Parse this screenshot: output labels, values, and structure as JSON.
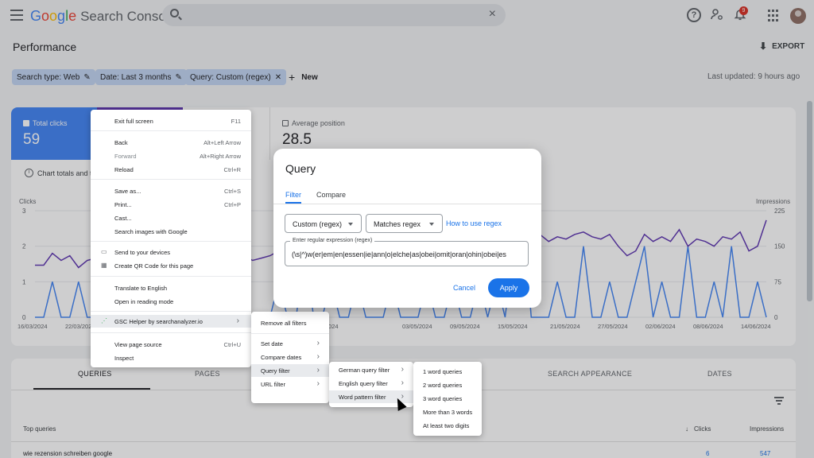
{
  "app": {
    "logo_google": [
      "G",
      "o",
      "o",
      "g",
      "l",
      "e"
    ],
    "logo_product": "Search Console",
    "clear_icon": "×",
    "notification_count": "9"
  },
  "header": {
    "title": "Performance",
    "export_label": "EXPORT",
    "last_updated": "Last updated: 9 hours ago"
  },
  "filters": {
    "chips": [
      {
        "label": "Search type: Web"
      },
      {
        "label": "Date: Last 3 months"
      },
      {
        "label": "Query: Custom (regex)"
      }
    ],
    "new_label": "New"
  },
  "metrics": {
    "total_clicks_label": "Total clicks",
    "total_clicks_value": "59",
    "avg_position_label": "Average position",
    "avg_position_value": "28.5",
    "note": "Chart totals and tal"
  },
  "chart_data": {
    "type": "line",
    "yaxis_left_label": "Clicks",
    "yaxis_right_label": "Impressions",
    "yticks_left": [
      "3",
      "2",
      "1",
      "0"
    ],
    "yticks_right": [
      "225",
      "150",
      "75",
      "0"
    ],
    "xtick_labels": [
      "16/03/2024",
      "22/03/2024",
      "27/04/2024",
      "03/05/2024",
      "09/05/2024",
      "15/05/2024",
      "21/05/2024",
      "27/05/2024",
      "02/06/2024",
      "08/06/2024",
      "14/06/2024"
    ],
    "ylim_left": [
      0,
      3
    ],
    "ylim_right": [
      0,
      225
    ],
    "series": [
      {
        "name": "Clicks",
        "color": "#4285f4",
        "values": [
          0,
          0,
          1,
          0,
          0,
          1,
          0,
          0,
          1,
          0,
          1,
          0,
          0,
          1,
          0,
          1,
          0,
          1,
          0,
          0,
          0,
          1,
          0,
          1,
          0,
          0,
          0,
          0,
          1,
          0,
          0,
          2,
          0,
          0,
          1,
          0,
          0,
          1,
          0,
          0,
          0,
          1,
          0,
          0,
          0,
          1,
          0,
          0,
          1,
          0,
          0,
          1,
          0,
          1,
          0,
          2,
          3,
          0,
          0,
          0,
          1,
          0,
          0,
          2,
          0,
          0,
          1,
          0,
          0,
          1,
          2,
          0,
          1,
          0,
          0,
          2,
          0,
          0,
          1,
          0,
          2,
          0,
          0,
          1,
          0
        ]
      },
      {
        "name": "Impressions",
        "color": "#5e35b1",
        "values": [
          110,
          110,
          135,
          120,
          130,
          105,
          120,
          125,
          95,
          115,
          130,
          120,
          120,
          140,
          120,
          130,
          115,
          140,
          130,
          125,
          120,
          135,
          130,
          140,
          130,
          120,
          125,
          130,
          140,
          130,
          125,
          150,
          140,
          135,
          140,
          150,
          140,
          135,
          145,
          140,
          150,
          140,
          135,
          130,
          145,
          150,
          140,
          135,
          150,
          140,
          135,
          145,
          155,
          150,
          160,
          170,
          180,
          190,
          175,
          160,
          170,
          165,
          175,
          180,
          170,
          165,
          175,
          150,
          130,
          140,
          175,
          160,
          170,
          160,
          185,
          150,
          165,
          160,
          150,
          170,
          165,
          180,
          140,
          150,
          205
        ]
      }
    ]
  },
  "context_menu": {
    "exit_fullscreen": "Exit full screen",
    "exit_fullscreen_sc": "F11",
    "back": "Back",
    "back_sc": "Alt+Left Arrow",
    "forward": "Forward",
    "forward_sc": "Alt+Right Arrow",
    "reload": "Reload",
    "reload_sc": "Ctrl+R",
    "save_as": "Save as...",
    "save_as_sc": "Ctrl+S",
    "print": "Print...",
    "print_sc": "Ctrl+P",
    "cast": "Cast...",
    "search_images": "Search images with Google",
    "send_devices": "Send to your devices",
    "qr_code": "Create QR Code for this page",
    "translate": "Translate to English",
    "reading_mode": "Open in reading mode",
    "gsc_helper": "GSC Helper by searchanalyzer.io",
    "view_source": "View page source",
    "view_source_sc": "Ctrl+U",
    "inspect": "Inspect"
  },
  "submenu1": {
    "remove_all": "Remove all filters",
    "set_date": "Set date",
    "compare_dates": "Compare dates",
    "query_filter": "Query filter",
    "url_filter": "URL filter"
  },
  "submenu2": {
    "german": "German query filter",
    "english": "English query filter",
    "word_pattern": "Word pattern filter"
  },
  "submenu3": {
    "one": "1 word queries",
    "two": "2 word queries",
    "three": "3 word queries",
    "more": "More than 3 words",
    "digits": "At least two digits"
  },
  "dialog": {
    "title": "Query",
    "tab_filter": "Filter",
    "tab_compare": "Compare",
    "select_type": "Custom (regex)",
    "select_match": "Matches regex",
    "regex_link": "How to use regex",
    "regex_label": "Enter regular expression (regex)",
    "regex_value": "(\\s|^)w(er|em|en|essen|ie|ann|o|elche|as|obei|omit|oran|ohin|obei|es",
    "cancel": "Cancel",
    "apply": "Apply"
  },
  "table": {
    "tabs": [
      "QUERIES",
      "PAGES",
      "SEARCH APPEARANCE",
      "DATES"
    ],
    "col_top_queries": "Top queries",
    "col_clicks": "Clicks",
    "col_impressions": "Impressions",
    "rows": [
      {
        "query": "wie rezension schreiben google",
        "clicks": "6",
        "impressions": "547"
      }
    ]
  }
}
